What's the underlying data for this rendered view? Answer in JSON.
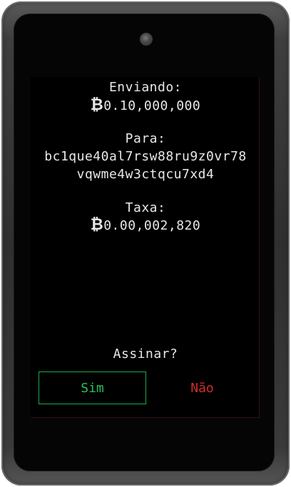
{
  "sending": {
    "label": "Enviando:",
    "currency_symbol": "₿",
    "amount": "0.10,000,000"
  },
  "recipient": {
    "label": "Para:",
    "address_line1": "bc1que40al7rsw88ru9z0vr78",
    "address_line2": "vqwme4w3ctqcu7xd4"
  },
  "fee": {
    "label": "Taxa:",
    "currency_symbol": "₿",
    "amount": "0.00,002,820"
  },
  "confirm": {
    "prompt": "Assinar?",
    "yes_label": "Sim",
    "no_label": "Não"
  },
  "colors": {
    "text": "#e8e8e8",
    "yes": "#26c25a",
    "no": "#d42a2a",
    "screen": "#000000"
  },
  "icons": {
    "camera": "front-camera-icon",
    "bitcoin": "bitcoin-symbol-icon"
  }
}
